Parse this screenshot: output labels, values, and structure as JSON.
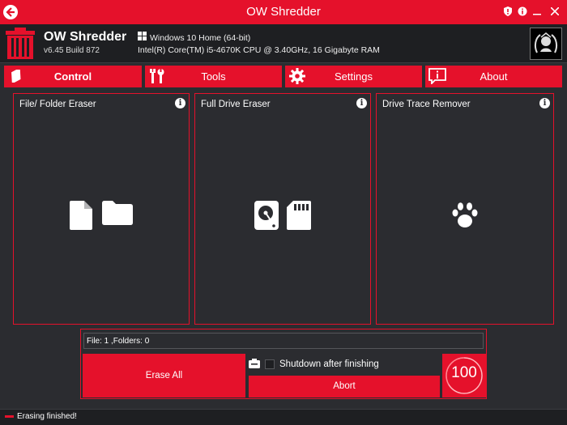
{
  "window": {
    "title": "OW Shredder"
  },
  "app": {
    "name": "OW Shredder",
    "version": "v6.45 Build 872",
    "os": "Windows 10 Home (64-bit)",
    "cpu": "Intel(R) Core(TM) i5-4670K CPU @ 3.40GHz, 16 Gigabyte RAM"
  },
  "tabs": [
    {
      "label": "Control",
      "icon": "eraser-icon",
      "active": true
    },
    {
      "label": "Tools",
      "icon": "tools-icon"
    },
    {
      "label": "Settings",
      "icon": "gear-icon"
    },
    {
      "label": "About",
      "icon": "info-message-icon"
    }
  ],
  "panels": [
    {
      "title": "File/ Folder Eraser",
      "icons": [
        "file-icon",
        "folder-icon"
      ]
    },
    {
      "title": "Full Drive Eraser",
      "icons": [
        "hard-disk-icon",
        "sd-card-icon"
      ]
    },
    {
      "title": "Drive Trace Remover",
      "icons": [
        "paw-icon"
      ]
    }
  ],
  "bottom": {
    "file_info": "File: 1 ,Folders: 0",
    "erase_all_label": "Erase All",
    "shutdown_label": "Shutdown after finishing",
    "abort_label": "Abort",
    "progress": "100"
  },
  "status": {
    "text": "Erasing finished!"
  },
  "colors": {
    "accent": "#e5112b",
    "background": "#2b2c30",
    "header": "#1e1f22"
  }
}
